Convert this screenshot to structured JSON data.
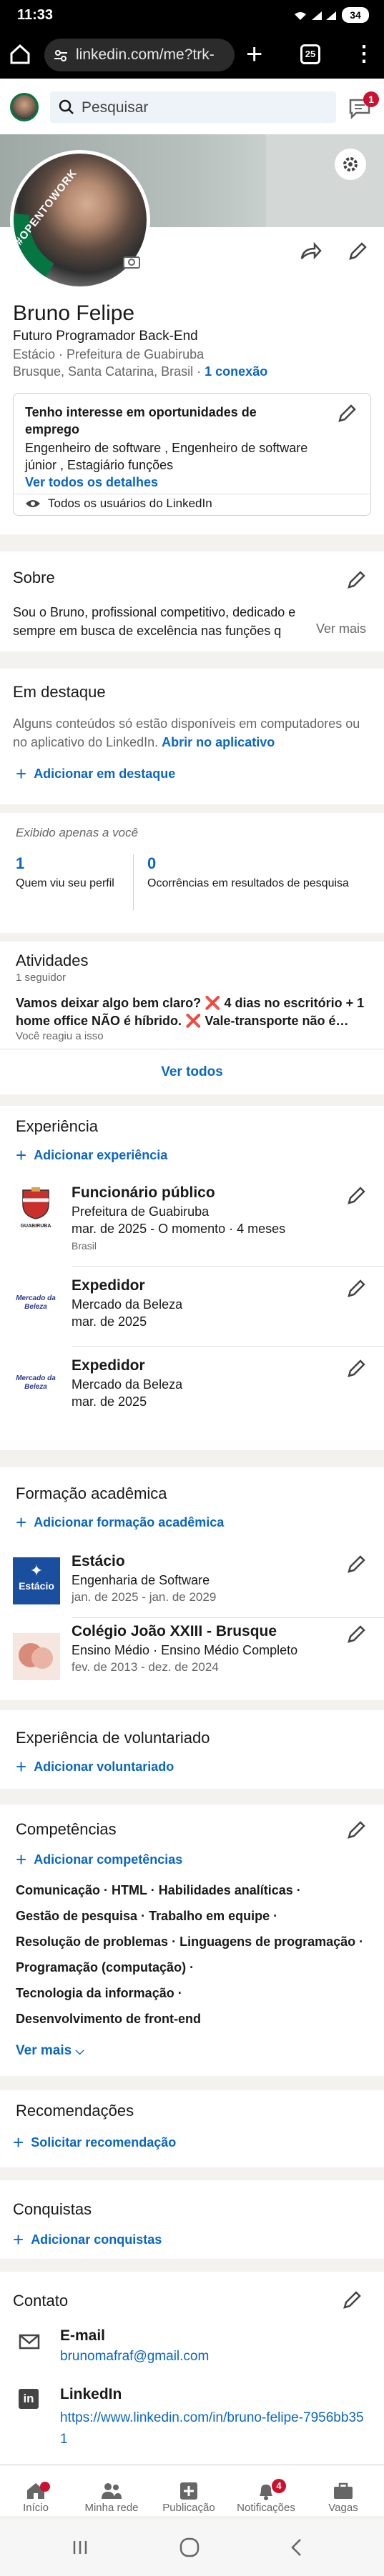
{
  "statusbar": {
    "time": "11:33",
    "battery": "34"
  },
  "browser": {
    "url": "linkedin.com/me?trk-",
    "tab_count": "25"
  },
  "topbar": {
    "search_placeholder": "Pesquisar",
    "messages_badge": "1"
  },
  "profile": {
    "frame_text": "#OPENTOWORK",
    "name": "Bruno Felipe",
    "headline": "Futuro Programador Back-End",
    "education": "Estácio",
    "company": "Prefeitura de Guabiruba",
    "location": "Brusque, Santa Catarina, Brasil",
    "connections": "1 conexão"
  },
  "open_to_work": {
    "title": "Tenho interesse em oportunidades de emprego",
    "roles": "Engenheiro de software , Engenheiro de software júnior , Estagiário funções",
    "link": "Ver todos os detalhes",
    "visibility": "Todos os usuários do LinkedIn"
  },
  "about": {
    "heading": "Sobre",
    "text": "Sou o Bruno, profissional competitivo, dedicado e sempre em busca de excelência nas funções q",
    "more": "Ver mais"
  },
  "featured": {
    "heading": "Em destaque",
    "text": "Alguns conteúdos só estão disponíveis em computadores ou no aplicativo do LinkedIn.",
    "app_link": "Abrir no aplicativo",
    "add": "Adicionar em destaque"
  },
  "analytics": {
    "note": "Exibido apenas a você",
    "stats": [
      {
        "value": "1",
        "label": "Quem viu seu perfil"
      },
      {
        "value": "0",
        "label": "Ocorrências em resultados de pesquisa"
      }
    ]
  },
  "activity": {
    "heading": "Atividades",
    "followers": "1 seguidor",
    "post": "Vamos deixar algo bem claro? ❌ 4 dias no escritório + 1 home office NÃO é híbrido. ❌ Vale-transporte não é…",
    "reaction": "Você reagiu a isso",
    "see_all": "Ver todos"
  },
  "experience": {
    "heading": "Experiência",
    "add": "Adicionar experiência",
    "items": [
      {
        "title": "Funcionário público",
        "org": "Prefeitura de Guabiruba",
        "dates": "mar. de 2025 - O momento",
        "duration": "4 meses",
        "place": "Brasil",
        "logo_text": "GUABIRUBA"
      },
      {
        "title": "Expedidor",
        "org": "Mercado da Beleza",
        "dates": "mar. de 2025",
        "logo_text": "Mercado da Beleza"
      },
      {
        "title": "Expedidor",
        "org": "Mercado da Beleza",
        "dates": "mar. de 2025",
        "logo_text": "Mercado da Beleza"
      }
    ]
  },
  "education_section": {
    "heading": "Formação acadêmica",
    "add": "Adicionar formação acadêmica",
    "items": [
      {
        "school": "Estácio",
        "degree": "Engenharia de Software",
        "dates": "jan. de 2025 - jan. de 2029",
        "logo_text": "Estácio"
      },
      {
        "school": "Colégio João XXIII - Brusque",
        "degree": "Ensino Médio",
        "field": "Ensino Médio Completo",
        "dates": "fev. de 2013 - dez. de 2024"
      }
    ]
  },
  "volunteer": {
    "heading": "Experiência de voluntariado",
    "add": "Adicionar voluntariado"
  },
  "skills": {
    "heading": "Competências",
    "add": "Adicionar competências",
    "rows": [
      [
        "Comunicação",
        "HTML",
        "Habilidades analíticas"
      ],
      [
        "Gestão de pesquisa",
        "Trabalho em equipe"
      ],
      [
        "Resolução de problemas",
        "Linguagens de programação"
      ],
      [
        "Programação (computação)"
      ],
      [
        "Tecnologia da informação"
      ],
      [
        "Desenvolvimento de front-end"
      ]
    ],
    "more": "Ver mais"
  },
  "recommendations": {
    "heading": "Recomendações",
    "add": "Solicitar recomendação"
  },
  "accomplishments": {
    "heading": "Conquistas",
    "add": "Adicionar conquistas"
  },
  "contact": {
    "heading": "Contato",
    "email_label": "E-mail",
    "email": "brunomafraf@gmail.com",
    "linkedin_label": "LinkedIn",
    "linkedin_url": "https://www.linkedin.com/in/bruno-felipe-7956bb351"
  },
  "bottom_nav": [
    {
      "label": "Início",
      "badge": ""
    },
    {
      "label": "Minha rede",
      "badge": ""
    },
    {
      "label": "Publicação",
      "badge": ""
    },
    {
      "label": "Notificações",
      "badge": "4"
    },
    {
      "label": "Vagas",
      "badge": ""
    }
  ],
  "colors": {
    "brand_blue": "#0a66c2",
    "open_green": "#057642",
    "badge_red": "#cb112d"
  }
}
